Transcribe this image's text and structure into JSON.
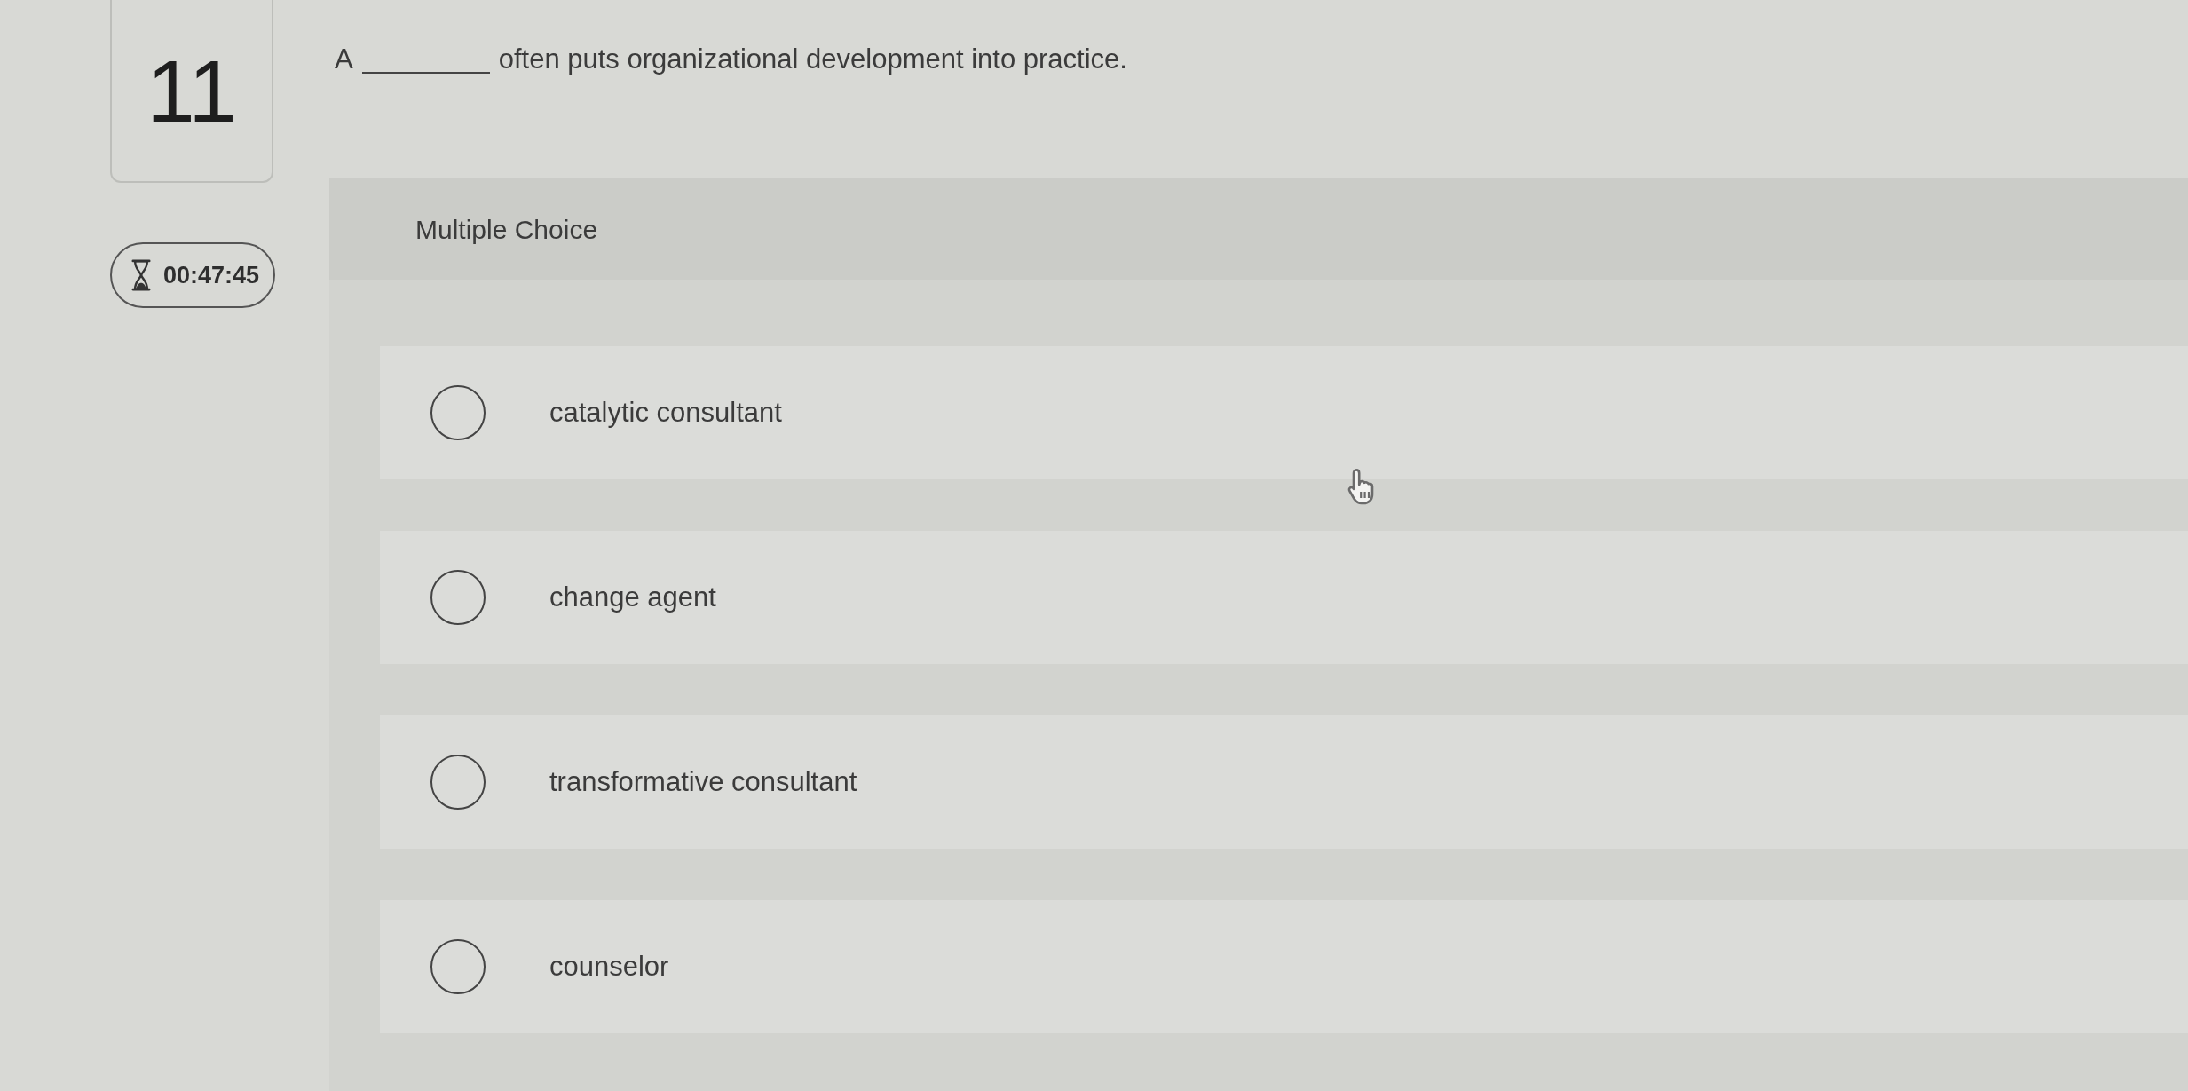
{
  "question": {
    "number": "11",
    "timer": "00:47:45",
    "text_before_blank": "A",
    "text_after_blank": "often puts organizational development into practice."
  },
  "panel": {
    "title": "Multiple Choice"
  },
  "options": [
    {
      "label": "catalytic consultant",
      "selected": false
    },
    {
      "label": "change agent",
      "selected": false
    },
    {
      "label": "transformative consultant",
      "selected": false
    },
    {
      "label": "counselor",
      "selected": false
    }
  ]
}
